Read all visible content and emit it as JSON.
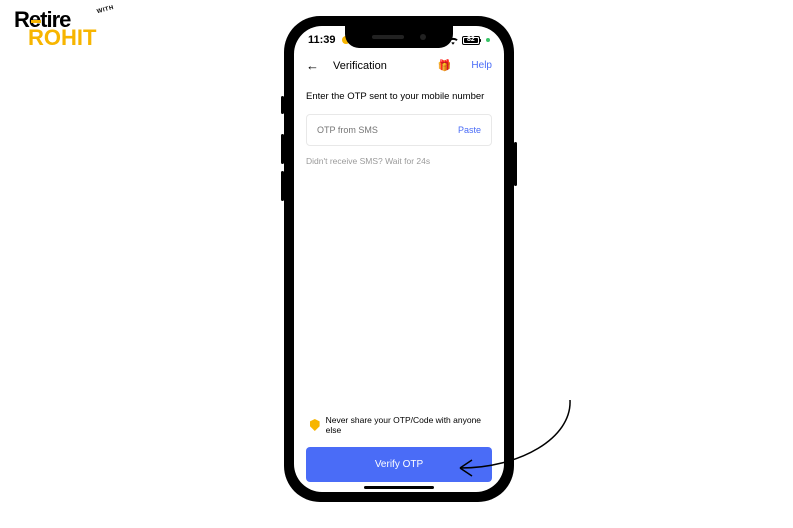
{
  "logo": {
    "line1": "Retire",
    "line2": "ROHIT"
  },
  "status": {
    "time": "11:39",
    "battery": "82"
  },
  "header": {
    "title": "Verification",
    "help_label": "Help"
  },
  "otp": {
    "instruction": "Enter the OTP sent to your mobile number",
    "placeholder": "OTP from SMS",
    "paste_label": "Paste",
    "wait_text": "Didn't receive SMS? Wait for 24s"
  },
  "footer": {
    "warning": "Never share your OTP/Code with anyone else",
    "verify_label": "Verify OTP"
  }
}
